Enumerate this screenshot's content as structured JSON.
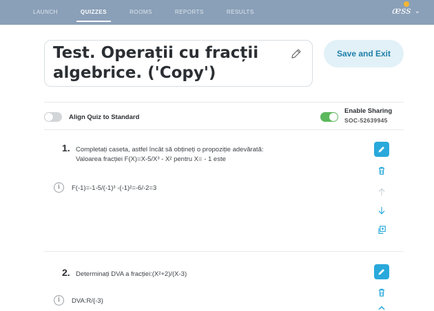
{
  "nav": {
    "items": [
      {
        "label": "LAUNCH",
        "active": false
      },
      {
        "label": "QUIZZES",
        "active": true
      },
      {
        "label": "ROOMS",
        "active": false
      },
      {
        "label": "REPORTS",
        "active": false
      },
      {
        "label": "RESULTS",
        "active": false
      }
    ],
    "user_label": "æss"
  },
  "quiz": {
    "title": "Test. Operații cu fracții algebrice. ('Copy')",
    "save_label": "Save and Exit"
  },
  "settings": {
    "align_label": "Align Quiz to Standard",
    "align_on": false,
    "sharing_label": "Enable Sharing",
    "sharing_on": true,
    "sharing_code": "SOC-52639945"
  },
  "questions": [
    {
      "number": "1.",
      "line1": "Completați caseta, astfel încât să obțineți o propoziție adevărată:",
      "line2": "Valoarea fracției F(X)=X-5/X³ - X²  pentru X= - 1 este",
      "answer": "F(-1)=-1-5/(-1)³ -(-1)²=-6/-2=3"
    },
    {
      "number": "2.",
      "line1": "Determinați DVA a fracției:(X²+2)/(X-3)",
      "answer": "DVA:R/{-3}"
    }
  ],
  "colors": {
    "topbar": "#8aa0b8",
    "accent": "#29a9db",
    "toggle_on": "#5cb85c",
    "save_bg": "#e2f1f8"
  },
  "icons": [
    "pencil-icon",
    "edit-icon",
    "trash-icon",
    "arrow-up-icon",
    "arrow-down-icon",
    "duplicate-icon",
    "info-icon",
    "chevron-down-icon"
  ]
}
